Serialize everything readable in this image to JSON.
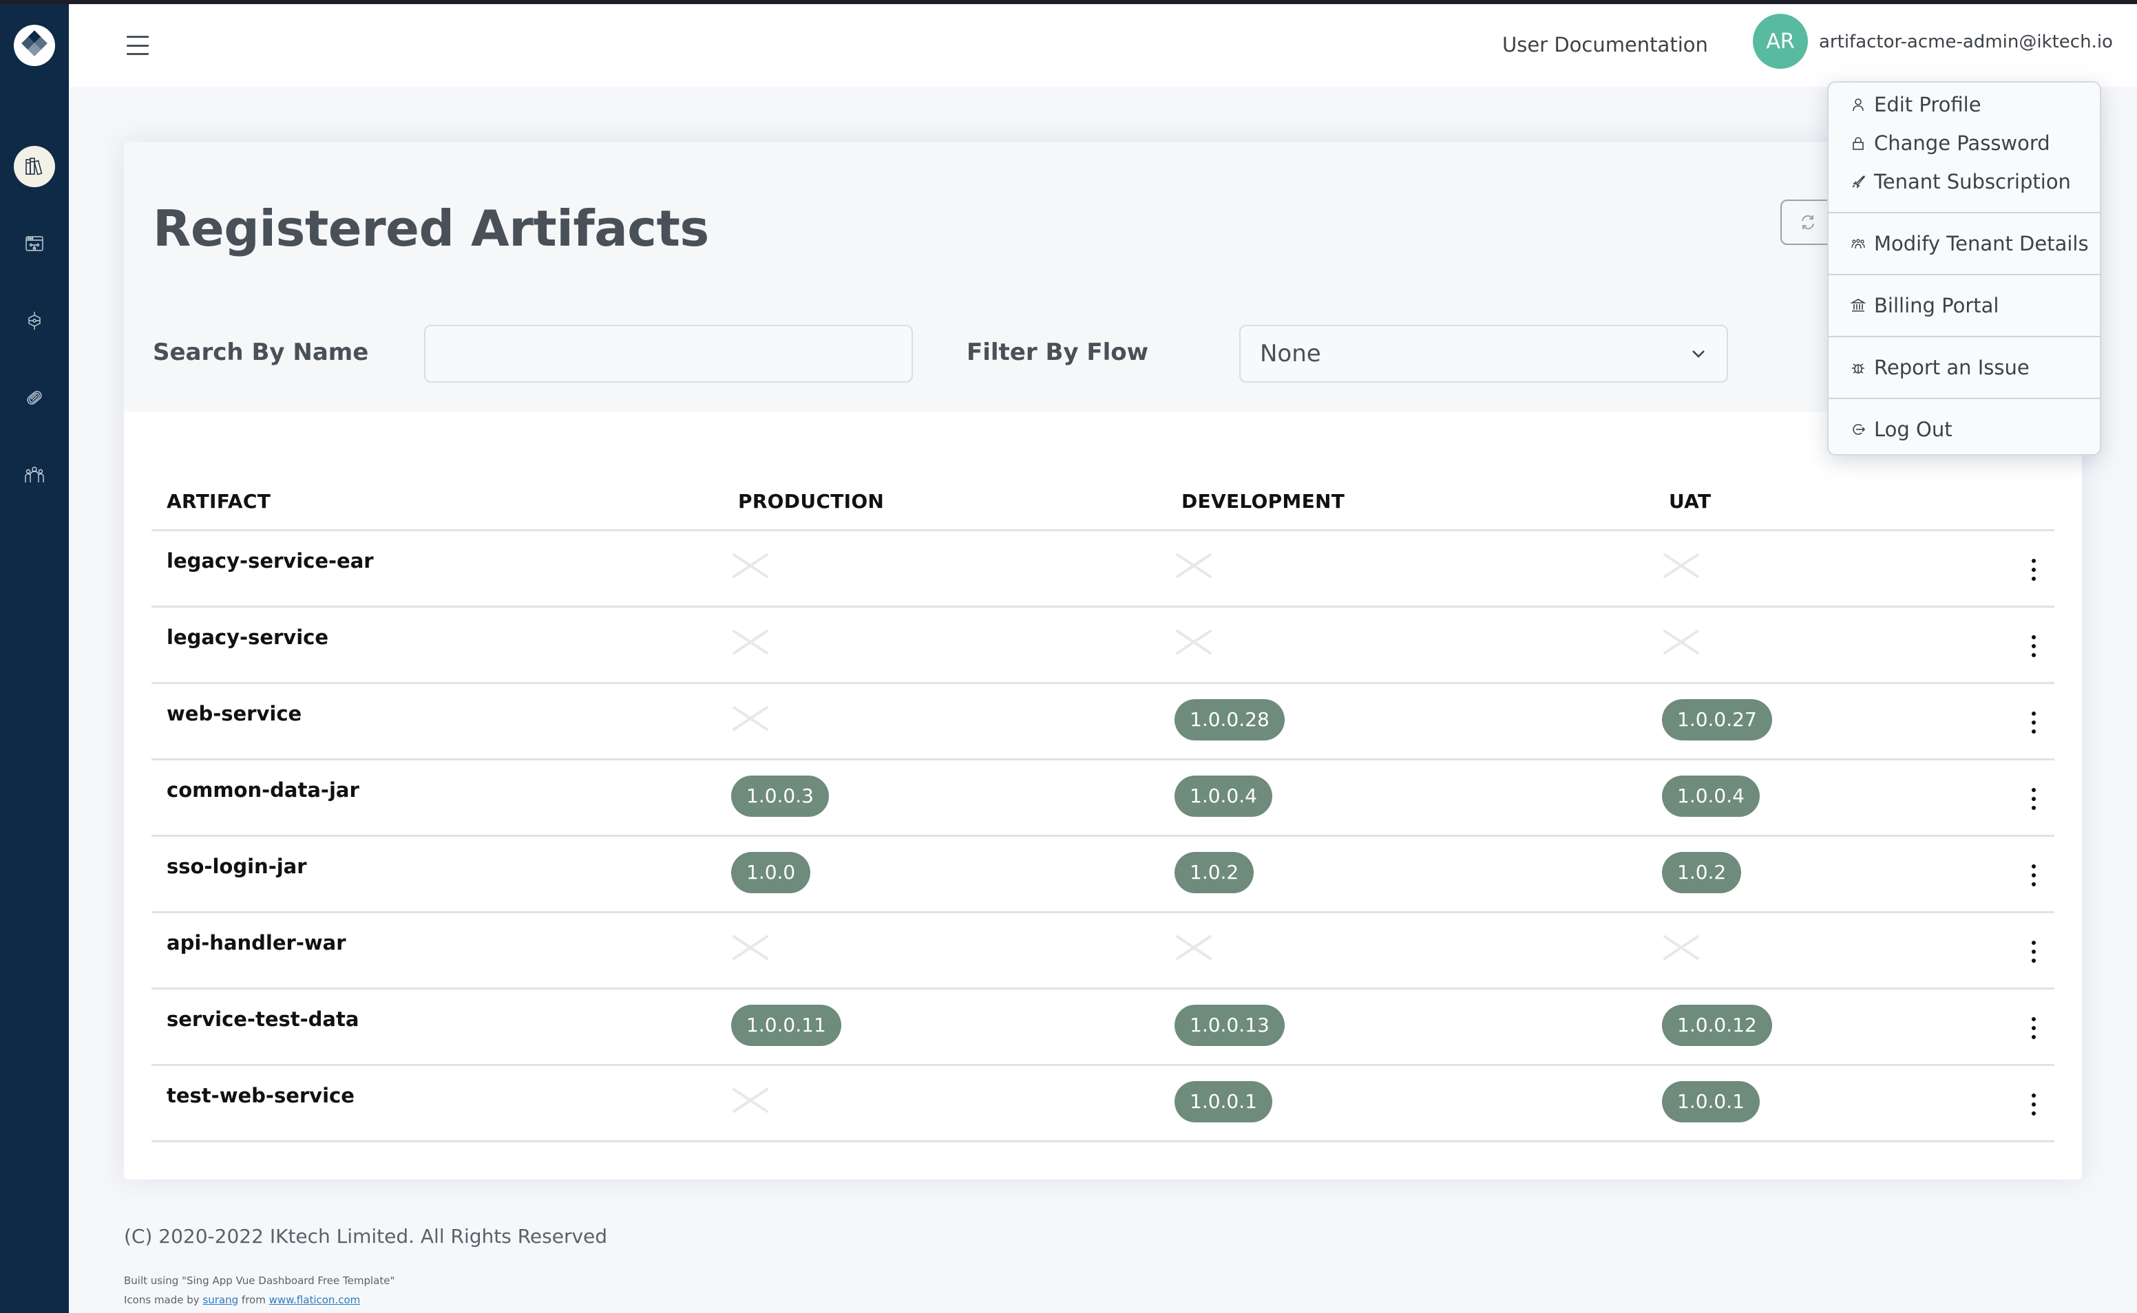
{
  "header": {
    "doc_link": "User Documentation",
    "avatar_initials": "AR",
    "user_email": "artifactor-acme-admin@iktech.io"
  },
  "sidebar": {
    "items": [
      {
        "icon": "books-icon",
        "label": "Artifacts",
        "active": true
      },
      {
        "icon": "flow-window-icon",
        "label": "Flows",
        "active": false
      },
      {
        "icon": "network-cube-icon",
        "label": "Stages",
        "active": false
      },
      {
        "icon": "tag-icon",
        "label": "Versions",
        "active": false
      },
      {
        "icon": "users-group-icon",
        "label": "Users",
        "active": false
      }
    ]
  },
  "page": {
    "title": "Registered Artifacts",
    "search_label": "Search By Name",
    "search_value": "",
    "search_placeholder": "",
    "filter_label": "Filter By Flow",
    "filter_value": "None"
  },
  "table": {
    "columns": [
      "ARTIFACT",
      "PRODUCTION",
      "DEVELOPMENT",
      "UAT"
    ],
    "rows": [
      {
        "name": "legacy-service-ear",
        "production": null,
        "development": null,
        "uat": null
      },
      {
        "name": "legacy-service",
        "production": null,
        "development": null,
        "uat": null
      },
      {
        "name": "web-service",
        "production": null,
        "development": "1.0.0.28",
        "uat": "1.0.0.27"
      },
      {
        "name": "common-data-jar",
        "production": "1.0.0.3",
        "development": "1.0.0.4",
        "uat": "1.0.0.4"
      },
      {
        "name": "sso-login-jar",
        "production": "1.0.0",
        "development": "1.0.2",
        "uat": "1.0.2"
      },
      {
        "name": "api-handler-war",
        "production": null,
        "development": null,
        "uat": null
      },
      {
        "name": "service-test-data",
        "production": "1.0.0.11",
        "development": "1.0.0.13",
        "uat": "1.0.0.12"
      },
      {
        "name": "test-web-service",
        "production": null,
        "development": "1.0.0.1",
        "uat": "1.0.0.1"
      }
    ]
  },
  "user_menu": {
    "groups": [
      [
        {
          "icon": "user-icon",
          "label": "Edit Profile"
        },
        {
          "icon": "lock-icon",
          "label": "Change Password"
        },
        {
          "icon": "rocket-icon",
          "label": "Tenant Subscription"
        }
      ],
      [
        {
          "icon": "group-icon",
          "label": "Modify Tenant Details"
        }
      ],
      [
        {
          "icon": "bank-icon",
          "label": "Billing Portal"
        }
      ],
      [
        {
          "icon": "bug-icon",
          "label": "Report an Issue"
        }
      ],
      [
        {
          "icon": "logout-icon",
          "label": "Log Out"
        }
      ]
    ]
  },
  "footer": {
    "copyright": "(C) 2020-2022 IKtech Limited. All Rights Reserved",
    "built_using": "Built using \"Sing App Vue Dashboard Free Template\"",
    "icons_prefix": "Icons made by ",
    "icons_author": "surang",
    "icons_mid": " from ",
    "icons_site": "www.flaticon.com"
  },
  "colors": {
    "sidebar_bg": "#0e2a47",
    "avatar_bg": "#58bb9f",
    "badge_bg": "#6e8b7c",
    "link": "#2b7bc0"
  }
}
